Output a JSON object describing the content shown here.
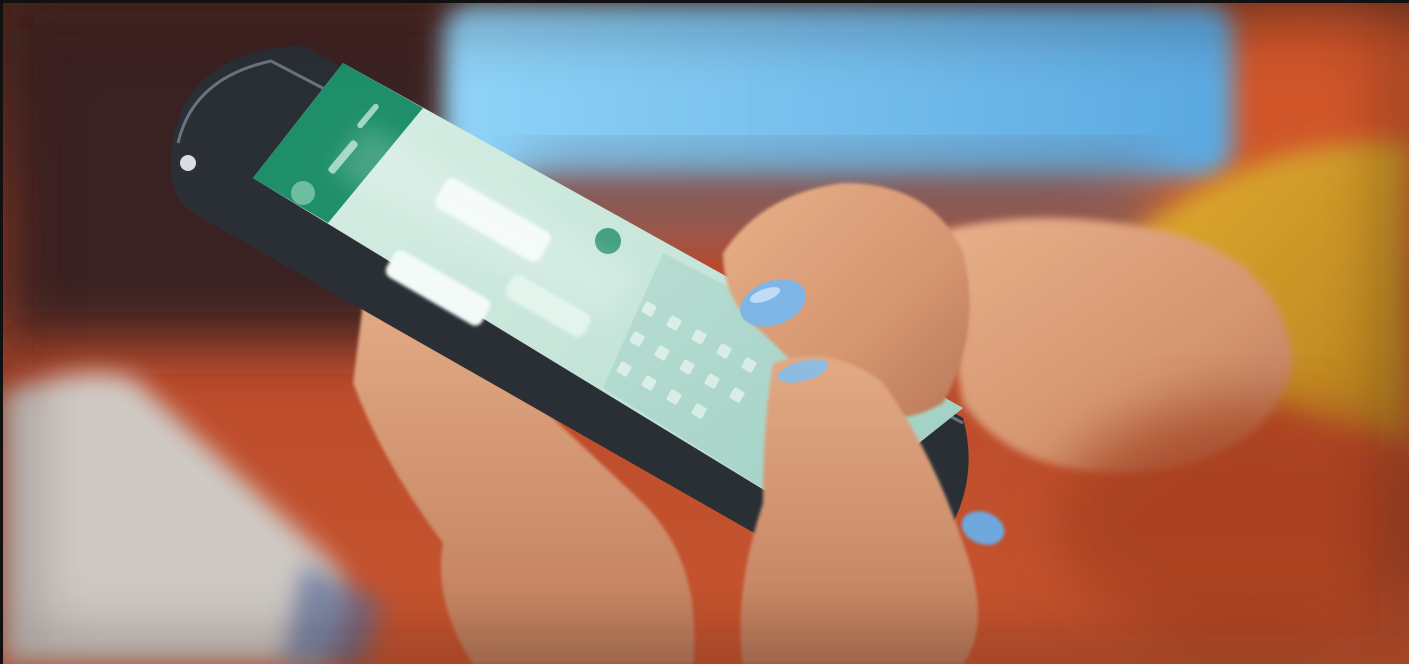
{
  "image": {
    "kind": "photo",
    "palette": {
      "table_orange": "#c9522a",
      "table_dark": "#8a3418",
      "monitor_glow": "#7cc6f0",
      "skin": "#d99a74",
      "skin_shadow": "#a8684a",
      "nail_blue": "#7fb6e6",
      "phone_body": "#2a2f36",
      "screen_green": "#1f8f6a",
      "screen_chat": "#cfe9df",
      "sleeve_yellow": "#d9a22a",
      "notebook_grey": "#c9c4c0"
    },
    "icons": [
      "smartphone",
      "chat-bubble",
      "keyboard"
    ]
  }
}
